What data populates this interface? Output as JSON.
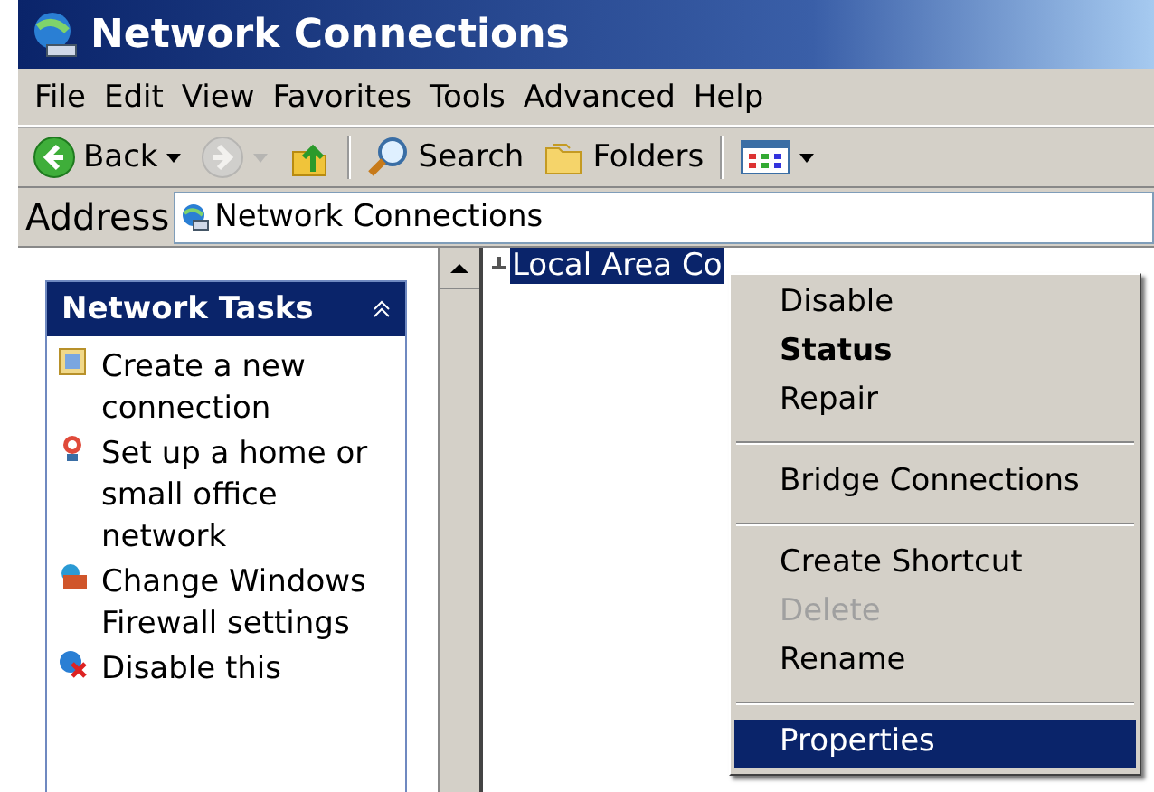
{
  "window": {
    "title": "Network Connections"
  },
  "menu_bar": [
    "File",
    "Edit",
    "View",
    "Favorites",
    "Tools",
    "Advanced",
    "Help"
  ],
  "toolbar": [
    {
      "kind": "back",
      "label": "Back",
      "disabled": false
    },
    {
      "kind": "forward",
      "disabled": true
    },
    {
      "kind": "up",
      "disabled": false
    },
    {
      "kind": "search",
      "label": "Search",
      "disabled": false
    },
    {
      "kind": "folders",
      "label": "Folders",
      "disabled": false
    },
    {
      "kind": "views",
      "disabled": false
    }
  ],
  "address": {
    "label": "Address",
    "value": "Network Connections"
  },
  "tasks": {
    "title": "Network Tasks",
    "expanded": true,
    "items": [
      {
        "kind": "new-connection",
        "label": "Create a new connection"
      },
      {
        "kind": "home-network",
        "label": "Set up a home or small office network"
      },
      {
        "kind": "firewall",
        "label": "Change Windows Firewall settings"
      },
      {
        "kind": "disable",
        "label": "Disable this"
      }
    ]
  },
  "files": [
    {
      "label": "Local Area Co",
      "selected": true
    }
  ],
  "context_menu": [
    {
      "kind": "item",
      "label": "Disable",
      "default": false,
      "disabled": false,
      "selected": false
    },
    {
      "kind": "item",
      "label": "Status",
      "default": true,
      "disabled": false,
      "selected": false
    },
    {
      "kind": "item",
      "label": "Repair",
      "default": false,
      "disabled": false,
      "selected": false
    },
    {
      "kind": "separator"
    },
    {
      "kind": "item",
      "label": "Bridge Connections",
      "default": false,
      "disabled": false,
      "selected": false
    },
    {
      "kind": "separator"
    },
    {
      "kind": "item",
      "label": "Create Shortcut",
      "default": false,
      "disabled": false,
      "selected": false
    },
    {
      "kind": "item",
      "label": "Delete",
      "default": false,
      "disabled": true,
      "selected": false
    },
    {
      "kind": "item",
      "label": "Rename",
      "default": false,
      "disabled": false,
      "selected": false
    },
    {
      "kind": "separator"
    },
    {
      "kind": "item",
      "label": "Properties",
      "default": false,
      "disabled": false,
      "selected": true
    }
  ]
}
